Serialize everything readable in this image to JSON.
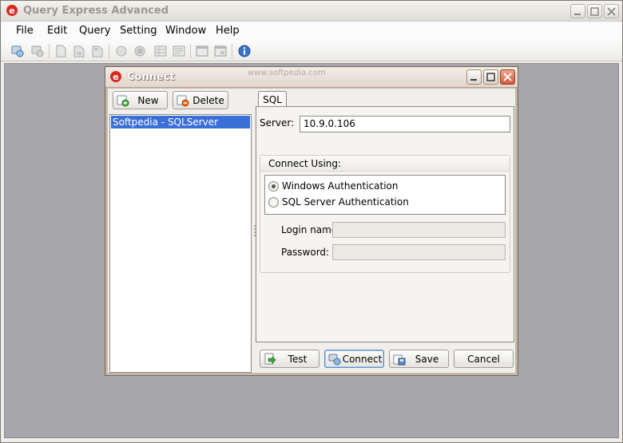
{
  "app": {
    "title": "Query Express Advanced",
    "menu": [
      "File",
      "Edit",
      "Query",
      "Setting",
      "Window",
      "Help"
    ]
  },
  "toolbar": {
    "icons": [
      "connect-icon",
      "disconnect-icon",
      "new-query-icon",
      "open-file-icon",
      "save-file-icon",
      "execute-icon",
      "stop-icon",
      "results-grid-icon",
      "results-text-icon",
      "window-icon",
      "window-alt-icon",
      "info-icon"
    ]
  },
  "dialog": {
    "title": "Connect",
    "watermark": "www.softpedia.com",
    "new_label": "New",
    "delete_label": "Delete",
    "connections": [
      "Softpedia - SQLServer"
    ],
    "tab_sql": "SQL",
    "server_label": "Server:",
    "server_value": "10.9.0.106",
    "group_title": "Connect Using:",
    "radio_windows": "Windows Authentication",
    "radio_sql": "SQL Server Authentication",
    "selected_auth": "Windows Authentication",
    "login_label": "Login name:",
    "login_value": "",
    "password_label": "Password:",
    "password_value": "",
    "test_label": "Test",
    "connect_label": "Connect",
    "save_label": "Save",
    "cancel_label": "Cancel"
  },
  "colors": {
    "selection": "#3b6fd8",
    "dialog_frame": "#c4b7aa",
    "workspace": "#a7a6aa"
  }
}
